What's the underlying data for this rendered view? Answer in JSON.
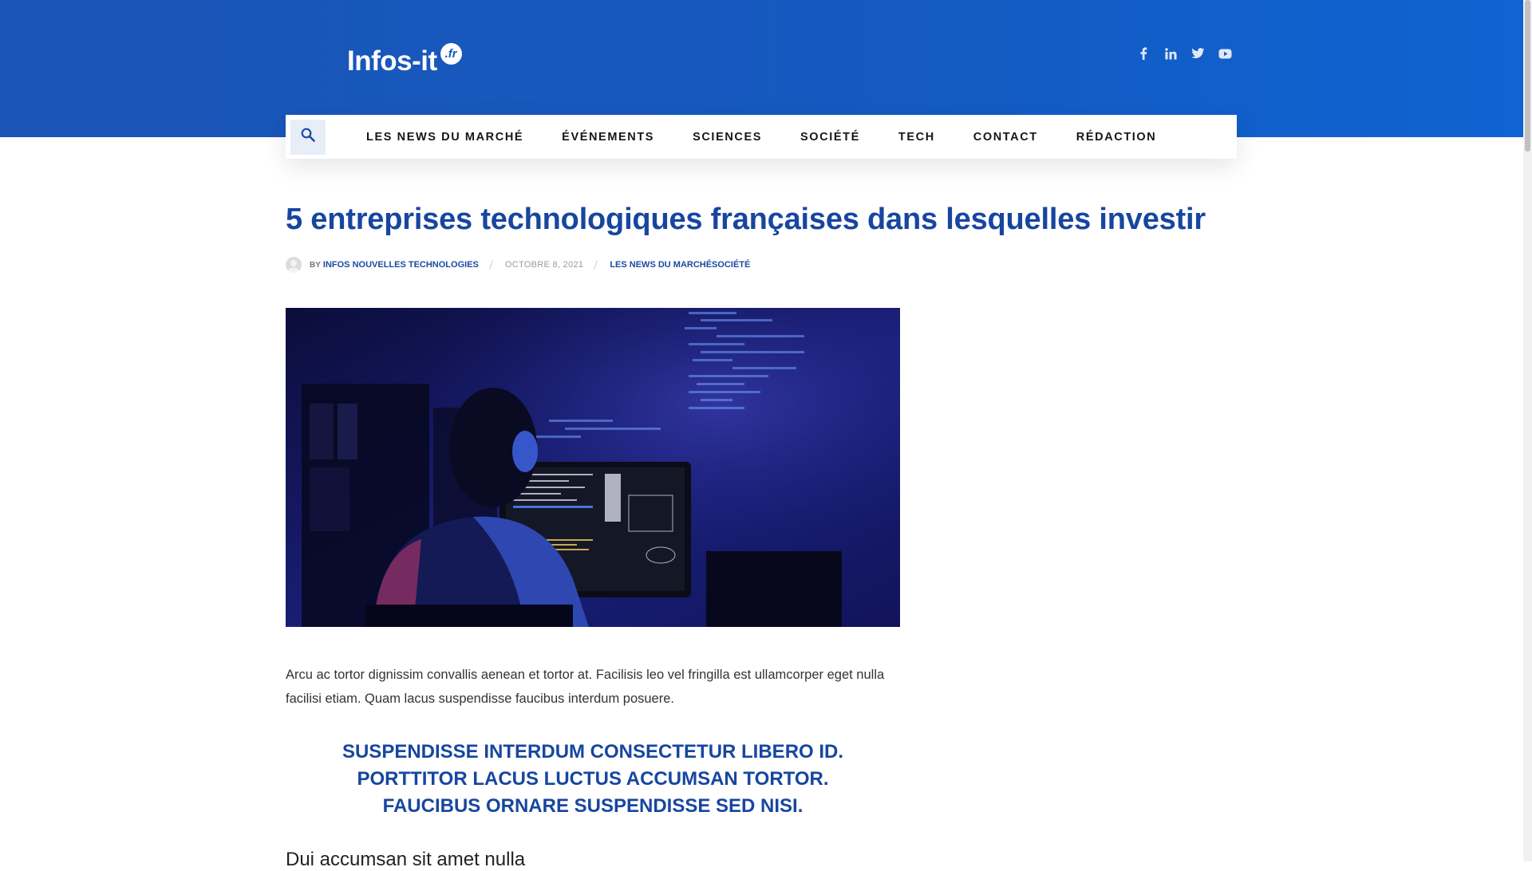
{
  "site": {
    "logo_text": "Infos-it",
    "logo_badge": ".fr"
  },
  "socials": [
    {
      "name": "facebook-icon"
    },
    {
      "name": "linkedin-icon"
    },
    {
      "name": "twitter-icon"
    },
    {
      "name": "youtube-icon"
    }
  ],
  "nav": {
    "search_icon": "search-icon",
    "items": [
      {
        "label": "LES NEWS DU MARCHÉ"
      },
      {
        "label": "ÉVÉNEMENTS"
      },
      {
        "label": "SCIENCES"
      },
      {
        "label": "SOCIÉTÉ"
      },
      {
        "label": "TECH"
      },
      {
        "label": "CONTACT"
      },
      {
        "label": "RÉDACTION"
      }
    ]
  },
  "article": {
    "title": "5 entreprises technologiques françaises dans lesquelles investir",
    "meta": {
      "by": "BY",
      "author": "INFOS NOUVELLES TECHNOLOGIES",
      "date": "OCTOBRE 8, 2021",
      "categories": "LES NEWS DU MARCHÉSOCIÉTÉ"
    },
    "paragraph": "Arcu ac tortor dignissim convallis aenean et tortor at. Facilisis leo vel fringilla est ullamcorper eget nulla facilisi etiam. Quam lacus suspendisse faucibus interdum posuere.",
    "highlight": [
      "SUSPENDISSE INTERDUM CONSECTETUR LIBERO ID.",
      "PORTTITOR LACUS LUCTUS ACCUMSAN TORTOR.",
      "FAUCIBUS ORNARE SUSPENDISSE SED NISI."
    ],
    "next_text": "Dui accumsan sit amet nulla"
  },
  "colors": {
    "header_blue": "#1559c0",
    "title_blue": "#1746a0"
  }
}
